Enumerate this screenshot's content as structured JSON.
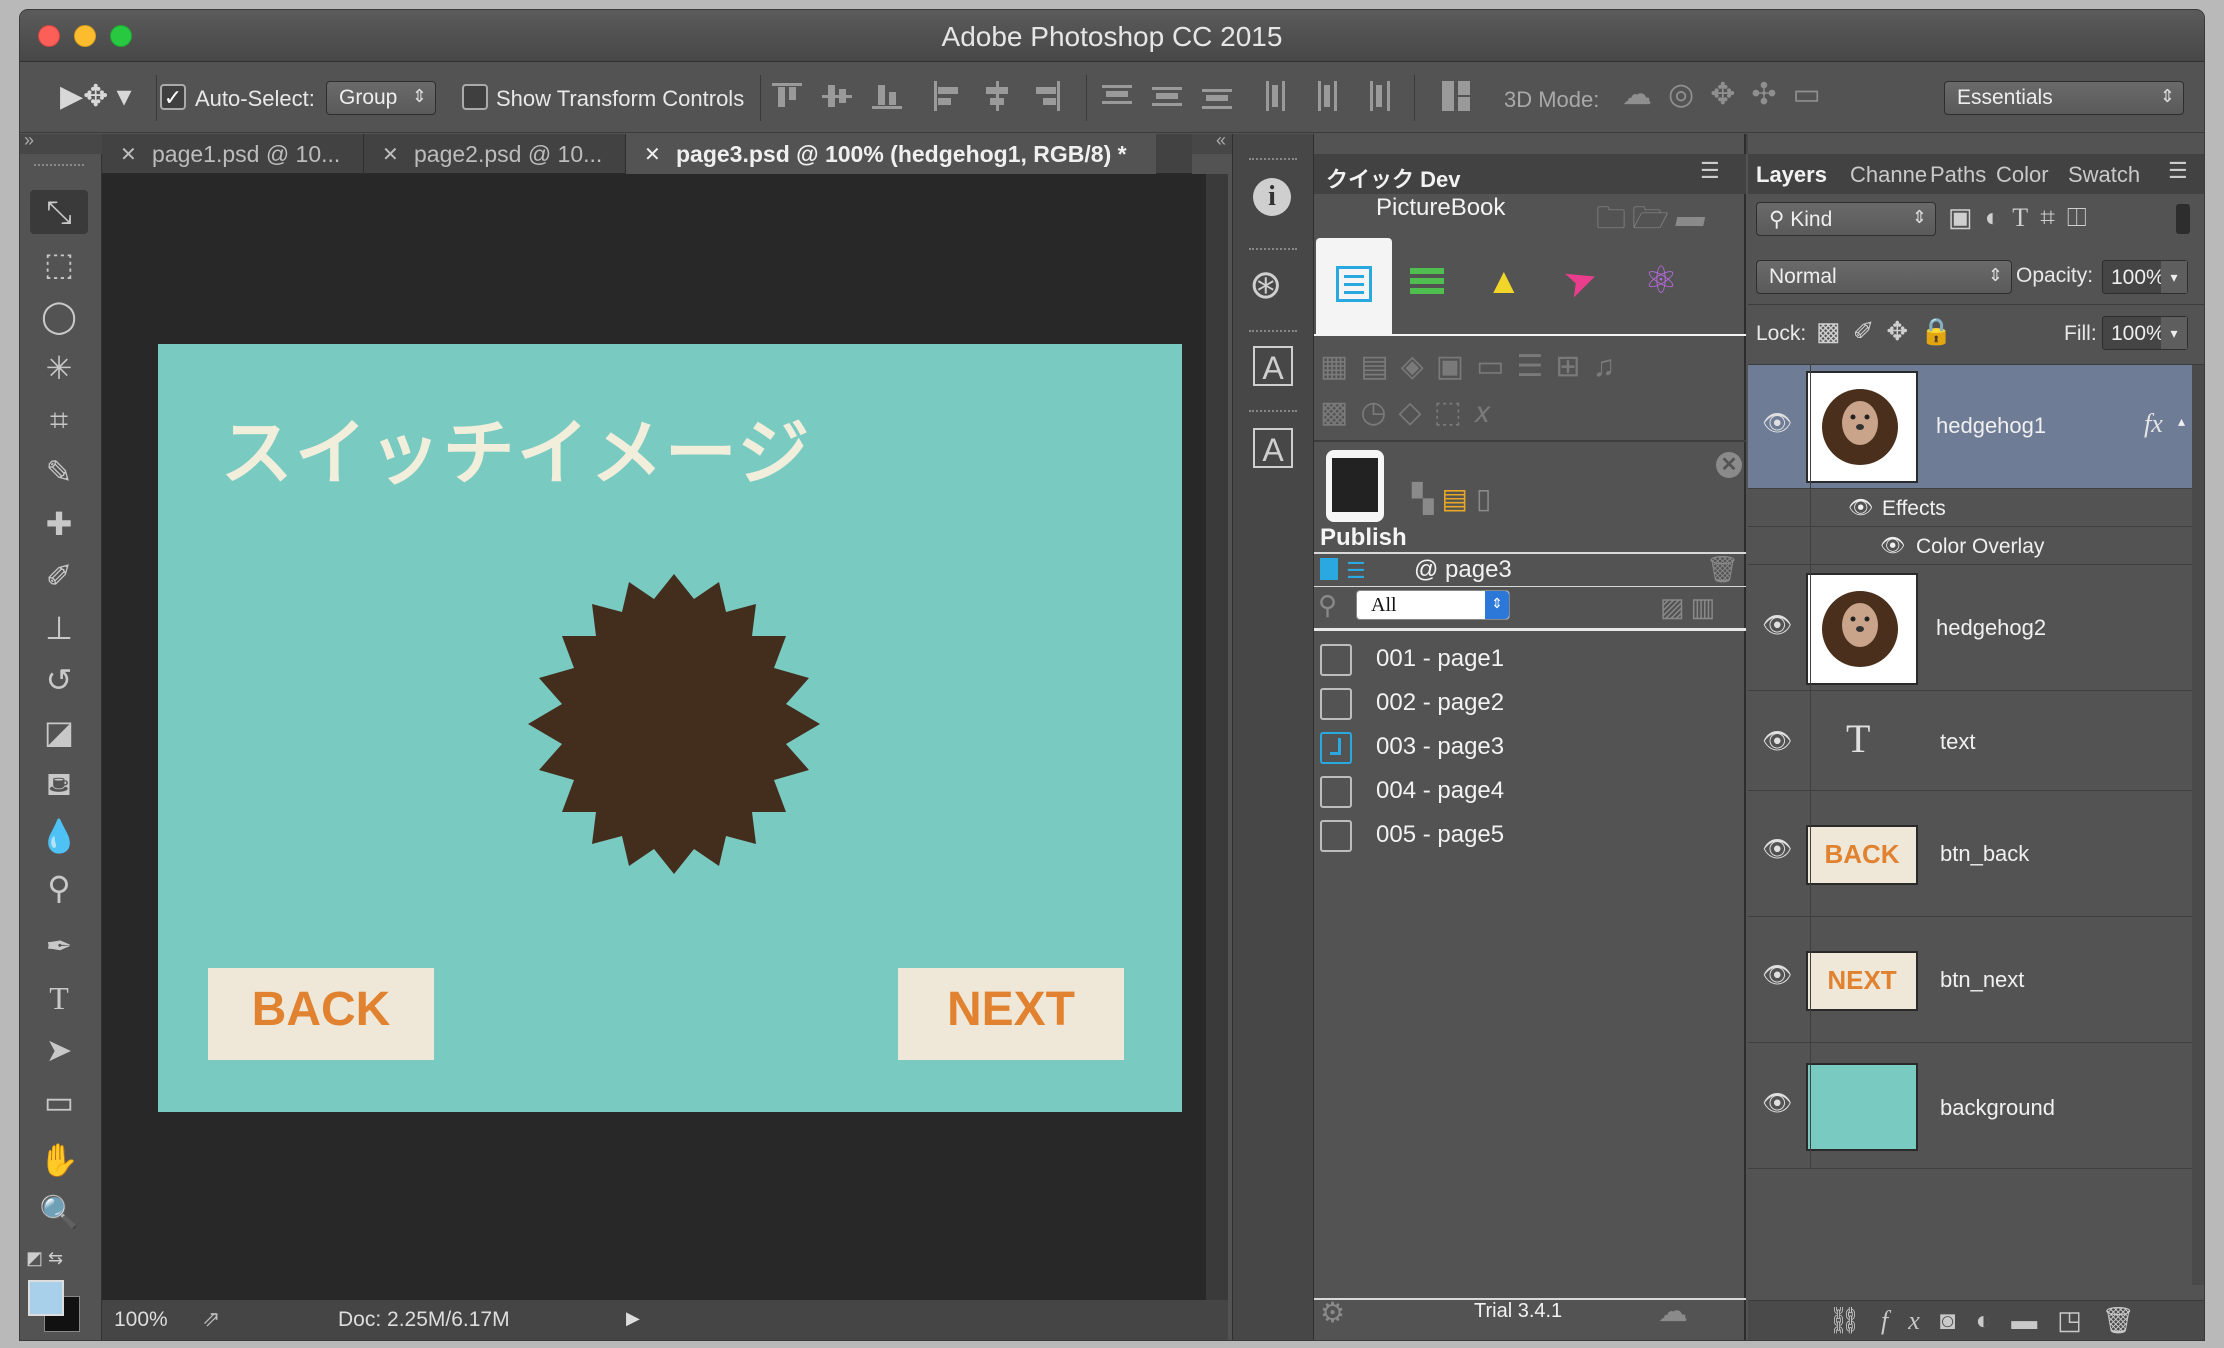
{
  "window": {
    "title": "Adobe Photoshop CC 2015"
  },
  "options_bar": {
    "auto_select_label": "Auto-Select:",
    "auto_select_value": "Group",
    "show_transform_label": "Show Transform Controls",
    "mode3d_label": "3D Mode:",
    "workspace": "Essentials"
  },
  "tabs": [
    {
      "label": "page1.psd @ 10..."
    },
    {
      "label": "page2.psd @ 10..."
    },
    {
      "label": "page3.psd @ 100% (hedgehog1, RGB/8) *"
    }
  ],
  "canvas": {
    "heading": "スイッチイメージ",
    "back_label": "BACK",
    "next_label": "NEXT",
    "colors": {
      "bg": "#79cac1",
      "button": "#efe8d8",
      "button_text": "#e0822f",
      "hedgehog": "#432e1d",
      "heading": "#f2eedc"
    }
  },
  "status": {
    "zoom": "100%",
    "doc": "Doc: 2.25M/6.17M"
  },
  "quick_panel": {
    "tab": "クイック Dev",
    "title": "PictureBook",
    "publish_label": "Publish",
    "page_ref": "@ page3",
    "filter_value": "All",
    "pages": [
      {
        "label": "001 - page1",
        "active": false
      },
      {
        "label": "002 - page2",
        "active": false
      },
      {
        "label": "003 - page3",
        "active": true
      },
      {
        "label": "004 - page4",
        "active": false
      },
      {
        "label": "005 - page5",
        "active": false
      }
    ],
    "version": "Trial 3.4.1"
  },
  "layers_panel": {
    "tabs": [
      "Layers",
      "Channe",
      "Paths",
      "Color",
      "Swatch"
    ],
    "kind": "Kind",
    "blend": "Normal",
    "opacity_label": "Opacity:",
    "opacity": "100%",
    "lock_label": "Lock:",
    "fill_label": "Fill:",
    "fill": "100%",
    "fx_label": "fx",
    "effects_label": "Effects",
    "color_overlay_label": "Color Overlay",
    "layers": [
      {
        "name": "hedgehog1",
        "selected": true
      },
      {
        "name": "hedgehog2"
      },
      {
        "name": "text"
      },
      {
        "name": "btn_back",
        "thumb_text": "BACK"
      },
      {
        "name": "btn_next",
        "thumb_text": "NEXT"
      },
      {
        "name": "background"
      }
    ]
  }
}
